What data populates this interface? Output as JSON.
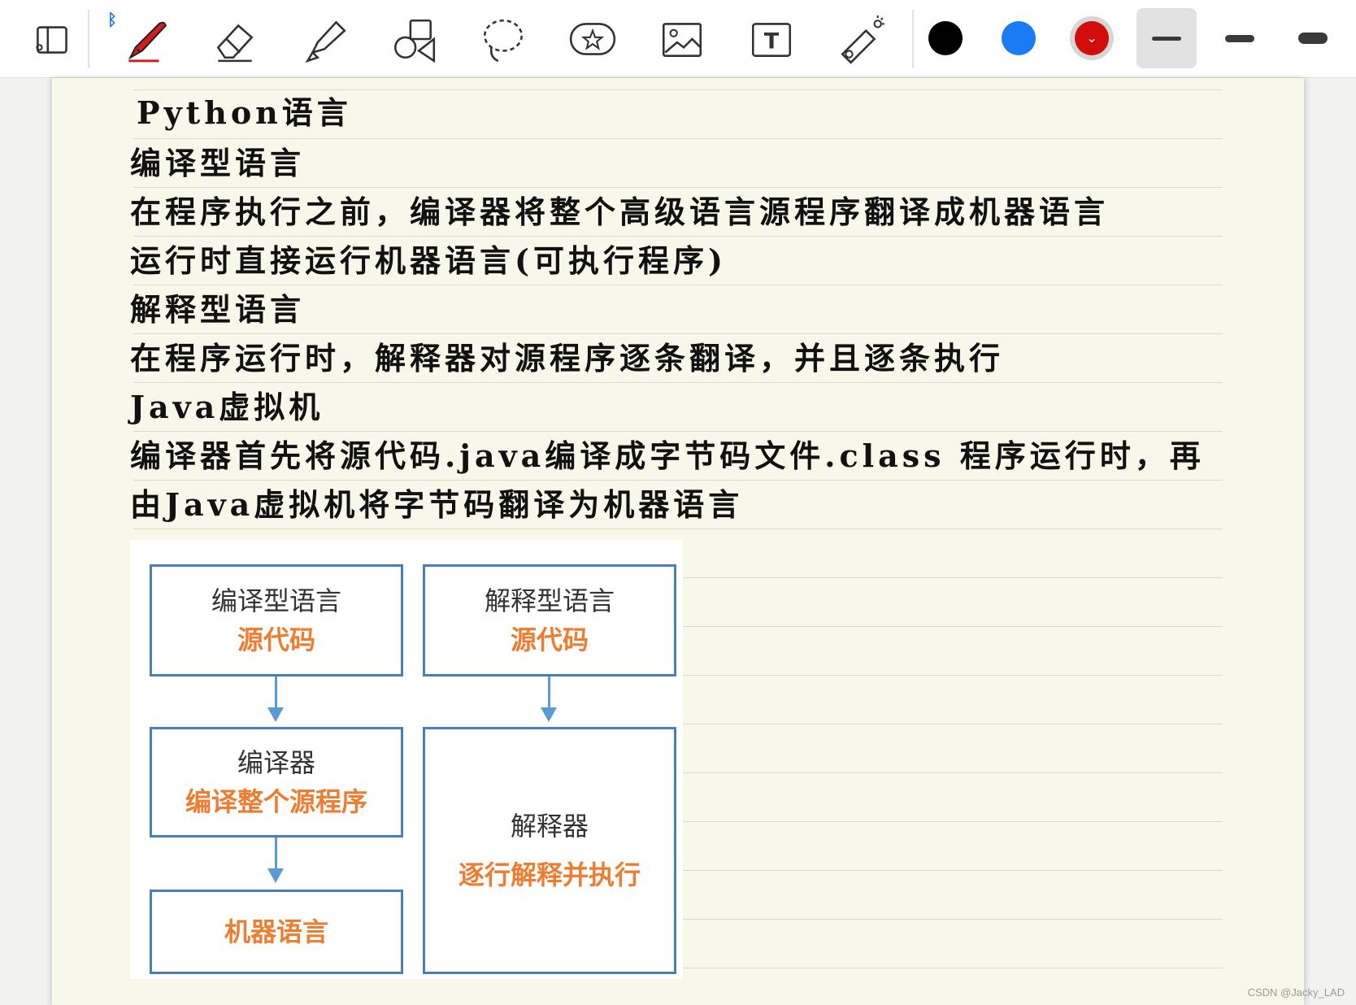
{
  "toolbar": {
    "tools": [
      {
        "name": "view-toggle-icon"
      },
      {
        "name": "pen-tool-icon"
      },
      {
        "name": "eraser-tool-icon"
      },
      {
        "name": "highlighter-tool-icon"
      },
      {
        "name": "shapes-tool-icon"
      },
      {
        "name": "lasso-tool-icon"
      },
      {
        "name": "sticker-tool-icon"
      },
      {
        "name": "image-tool-icon"
      },
      {
        "name": "text-tool-icon"
      },
      {
        "name": "laser-pointer-icon"
      }
    ],
    "bluetooth_icon": "bluetooth-icon",
    "colors": {
      "black": "#000000",
      "blue": "#1a7cf5",
      "red": "#d10d0d"
    },
    "selected_color": "red",
    "stroke_widths": [
      "thin",
      "medium",
      "thick"
    ],
    "selected_stroke": "thin"
  },
  "notes": {
    "lines": [
      "Python语言",
      "编译型语言",
      "在程序执行之前，编译器将整个高级语言源程序翻译成机器语言",
      "运行时直接运行机器语言(可执行程序)",
      "解释型语言",
      "在程序运行时，解释器对源程序逐条翻译，并且逐条执行",
      "Java虚拟机",
      "编译器首先将源代码.java编译成字节码文件.class 程序运行时，再",
      "由Java虚拟机将字节码翻译为机器语言"
    ]
  },
  "diagram": {
    "compiled": {
      "title": "编译型语言",
      "source": "源代码",
      "compiler": "编译器",
      "compiler_desc": "编译整个源程序",
      "output": "机器语言"
    },
    "interpreted": {
      "title": "解释型语言",
      "source": "源代码",
      "interpreter": "解释器",
      "interpreter_desc": "逐行解释并执行"
    },
    "colors": {
      "border": "#4a7eb4",
      "arrow": "#5b9bd5",
      "highlight": "#ed7d31"
    }
  },
  "watermark": "CSDN @Jacky_LAD"
}
